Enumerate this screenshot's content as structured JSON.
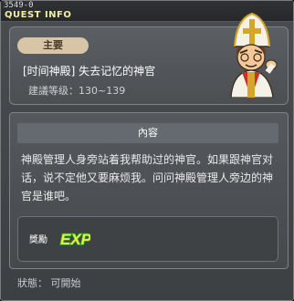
{
  "window": {
    "id": "3549-0",
    "title": "QUEST INFO"
  },
  "quest": {
    "category": "主要",
    "name": "[时间神殿] 失去记忆的神官",
    "recommended_level": "建議等级：130~139",
    "npc_icon": "priest-npc-portrait"
  },
  "details": {
    "section_title": "內容",
    "description": "神殿管理人身旁站着我帮助过的神官。如果跟神官对话，说不定他又要麻烦我。问问神殿管理人旁边的神官是谁吧。",
    "reward_label": "獎勵",
    "reward_icon": "exp-icon",
    "reward_text": "EXP"
  },
  "status": {
    "label": "狀態：",
    "value": "可開始"
  },
  "colors": {
    "window_bg": "#45484b",
    "title_text": "#f2f0a0",
    "category_pill": "#d8c4a6",
    "exp_yellow": "#e6f23a",
    "exp_green": "#2fa33a"
  }
}
